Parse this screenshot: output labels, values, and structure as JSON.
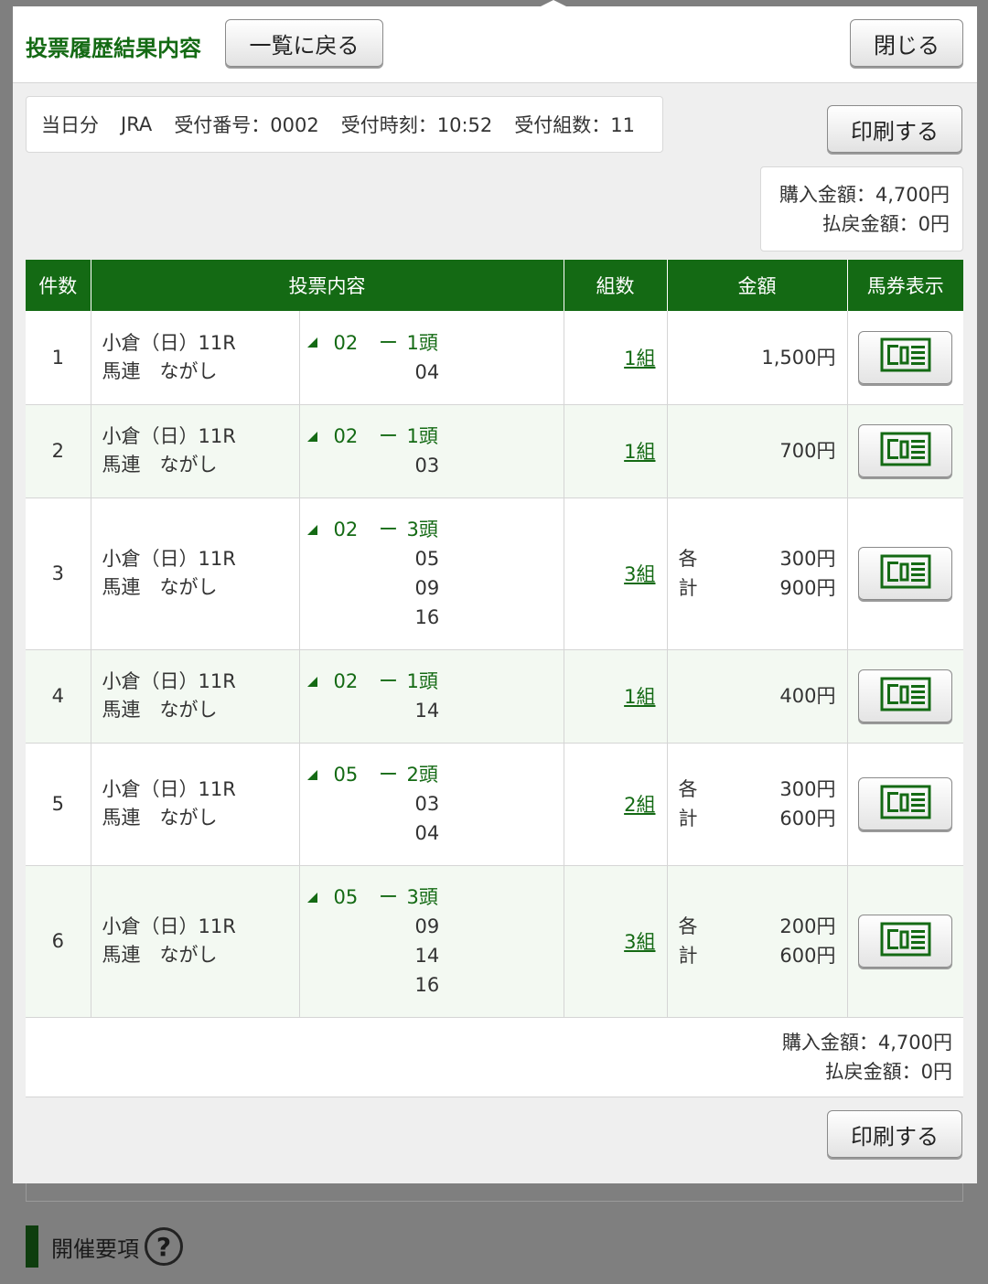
{
  "background": {
    "section_title": "開催要項",
    "help_icon": "?"
  },
  "modal": {
    "title": "投票履歴結果内容",
    "back_label": "一覧に戻る",
    "close_label": "閉じる",
    "print_label": "印刷する",
    "info": {
      "day": "当日分",
      "org": "JRA",
      "receipt_no": "受付番号：0002",
      "receipt_time": "受付時刻：10:52",
      "receipt_count": "受付組数：11"
    },
    "purchase_amount": "購入金額：4,700円",
    "refund_amount": "払戻金額：0円"
  },
  "table": {
    "headers": [
      "件数",
      "投票内容",
      "組数",
      "金額",
      "馬券表示"
    ],
    "rows": [
      {
        "num": "1",
        "race": "小倉（日）11R",
        "type": "馬連　ながし",
        "axis": "02",
        "dash": "ー",
        "count": "1頭",
        "partners": [
          "04"
        ],
        "kumi": "1組",
        "amount": "1,500円"
      },
      {
        "num": "2",
        "race": "小倉（日）11R",
        "type": "馬連　ながし",
        "axis": "02",
        "dash": "ー",
        "count": "1頭",
        "partners": [
          "03"
        ],
        "kumi": "1組",
        "amount": "700円"
      },
      {
        "num": "3",
        "race": "小倉（日）11R",
        "type": "馬連　ながし",
        "axis": "02",
        "dash": "ー",
        "count": "3頭",
        "partners": [
          "05",
          "09",
          "16"
        ],
        "kumi": "3組",
        "each_label": "各",
        "each": "300円",
        "total_label": "計",
        "total": "900円"
      },
      {
        "num": "4",
        "race": "小倉（日）11R",
        "type": "馬連　ながし",
        "axis": "02",
        "dash": "ー",
        "count": "1頭",
        "partners": [
          "14"
        ],
        "kumi": "1組",
        "amount": "400円"
      },
      {
        "num": "5",
        "race": "小倉（日）11R",
        "type": "馬連　ながし",
        "axis": "05",
        "dash": "ー",
        "count": "2頭",
        "partners": [
          "03",
          "04"
        ],
        "kumi": "2組",
        "each_label": "各",
        "each": "300円",
        "total_label": "計",
        "total": "600円"
      },
      {
        "num": "6",
        "race": "小倉（日）11R",
        "type": "馬連　ながし",
        "axis": "05",
        "dash": "ー",
        "count": "3頭",
        "partners": [
          "09",
          "14",
          "16"
        ],
        "kumi": "3組",
        "each_label": "各",
        "each": "200円",
        "total_label": "計",
        "total": "600円"
      }
    ]
  },
  "colors": {
    "brand_green": "#146a14",
    "row_alt": "#f3f9f2",
    "overlay": "#7f7f7f"
  },
  "icons": {
    "ticket": "ticket-icon",
    "triangle": "triangle-marker-icon",
    "help": "help-icon"
  }
}
